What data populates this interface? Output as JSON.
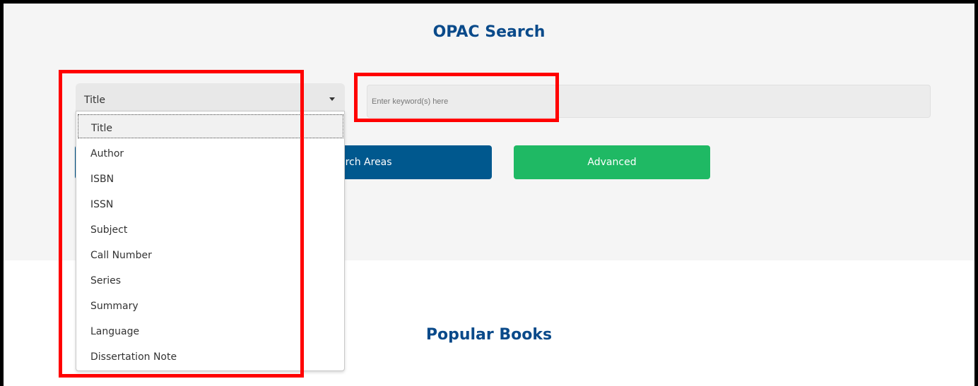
{
  "page": {
    "search_heading": "OPAC Search",
    "popular_heading": "Popular Books"
  },
  "search": {
    "field_select_value": "Title",
    "keyword_placeholder": "Enter keyword(s) here",
    "search_areas_label": "Search Areas",
    "search_areas_visible_label": "arch Areas",
    "advanced_label": "Advanced"
  },
  "dropdown": {
    "options": [
      "Title",
      "Author",
      "ISBN",
      "ISSN",
      "Subject",
      "Call Number",
      "Series",
      "Summary",
      "Language",
      "Dissertation Note"
    ],
    "selected": "Title"
  },
  "colors": {
    "heading": "#0a4a8a",
    "search_areas_button": "#00588e",
    "advanced_button": "#1fb964",
    "highlight_box": "#ff0000"
  }
}
